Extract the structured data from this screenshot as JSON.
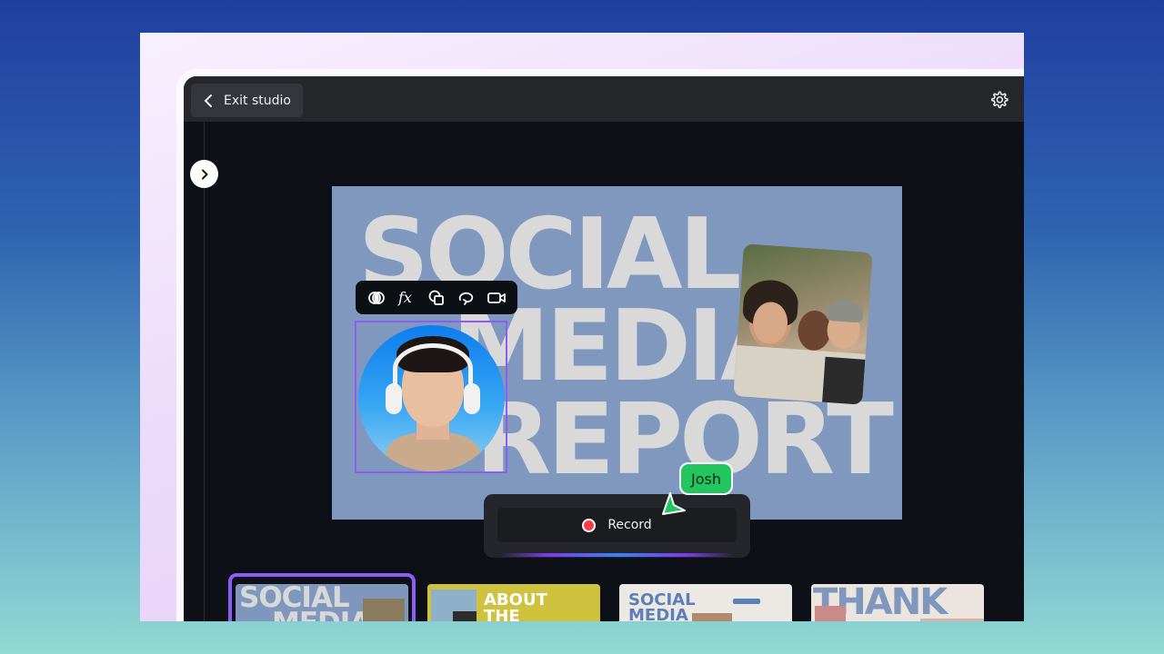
{
  "studio": {
    "exit_label": "Exit studio"
  },
  "slide": {
    "title_line1": "SOCIAL",
    "title_line2": "MEDIA",
    "title_line3": "REPORT",
    "background_color": "#8098bd"
  },
  "toolbar": {
    "tools": [
      "color-adjust-icon",
      "effects-fx-icon",
      "shapes-icon",
      "loop-icon",
      "camera-icon"
    ]
  },
  "recorder": {
    "record_label": "Record",
    "accent_color": "#ff3b48"
  },
  "collaborator": {
    "name": "Josh",
    "color": "#22c55e"
  },
  "thumbnails": [
    {
      "line1": "SOCIAL",
      "line2": "MEDIA",
      "selected": true
    },
    {
      "line1": "ABOUT",
      "line2": "THE",
      "selected": false
    },
    {
      "line1": "SOCIAL",
      "line2": "MEDIA",
      "selected": false
    },
    {
      "line1": "THANK",
      "line2": "",
      "selected": false
    }
  ]
}
